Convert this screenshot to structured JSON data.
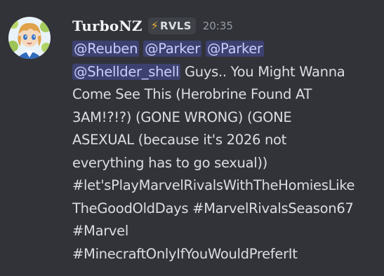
{
  "message": {
    "username": "TurboNZ",
    "clan_tag": {
      "icon": "lightning-bolt-icon",
      "icon_glyph": "⚡",
      "text": "RVLS",
      "icon_color": "#f0b232"
    },
    "timestamp": "20:35",
    "mentions": [
      "@Reuben",
      "@Parker",
      "@Parker",
      "@Shellder_shell"
    ],
    "text_lines": [
      "Guys.. You Might Wanna",
      "Come See This (Herobrine Found AT",
      "3AM!?!?) (GONE WRONG) (GONE",
      "ASEXUAL (because it's 2026 not",
      "everything has to go sexual))",
      "#let'sPlayMarvelRivalsWithTheHomiesLike",
      "TheGoodOldDays #MarvelRivalsSeason67",
      "#Marvel",
      "#MinecraftOnlyIfYouWouldPreferIt"
    ]
  },
  "colors": {
    "background": "#323339",
    "mention_bg": "rgba(88,101,242,0.3)",
    "mention_text": "#c9cdfb",
    "text": "#dbdee1",
    "timestamp": "#949ba4"
  }
}
